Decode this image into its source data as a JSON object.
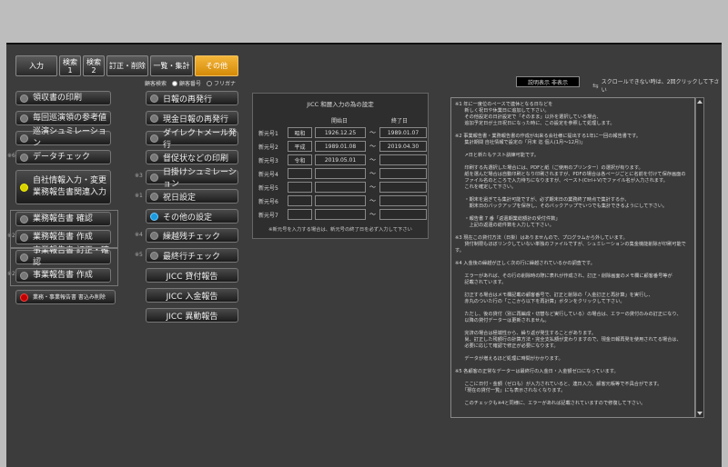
{
  "tabs": [
    {
      "label": "入力",
      "active": false
    },
    {
      "label": "検索\n1",
      "active": false
    },
    {
      "label": "検索\n2",
      "active": false
    },
    {
      "label": "訂正・削除",
      "active": false
    },
    {
      "label": "一覧・集計",
      "active": false
    },
    {
      "label": "その他",
      "active": true
    }
  ],
  "search_mode": {
    "label": "顧客検索",
    "opt1": "顧客番号",
    "opt2": "フリガナ",
    "selected": "顧客番号"
  },
  "left_buttons": [
    {
      "label": "領収書の印刷",
      "dot": "gray"
    },
    {
      "label": "毎回巡演領の参考値",
      "dot": "gray"
    },
    {
      "label": "巡演シュミレーション",
      "dot": "gray"
    },
    {
      "label": "データチェック",
      "dot": "gray"
    },
    {
      "label": "自社情報入力・変更\n業務報告書関連入力",
      "dot": "yellow"
    },
    {
      "label": "業務報告書 確認",
      "dot": "gray"
    },
    {
      "label": "業務報告書 作成",
      "dot": "gray"
    },
    {
      "label": "事業報告書 訂正・確認",
      "dot": "gray"
    },
    {
      "label": "事業報告書 作成",
      "dot": "gray"
    },
    {
      "label": "業務・事業報告書 書込み削除",
      "dot": "red"
    }
  ],
  "left_notes": [
    "※6",
    "※2",
    "※2"
  ],
  "mid_buttons": [
    {
      "label": "日報の再発行",
      "dot": "gray"
    },
    {
      "label": "現金日報の再発行",
      "dot": "gray"
    },
    {
      "label": "ダイレクトメール発行",
      "dot": "gray"
    },
    {
      "label": "督促状などの印刷",
      "dot": "gray"
    },
    {
      "label": "日掛けシュミレーション",
      "dot": "gray"
    },
    {
      "label": "祝日設定",
      "dot": "gray"
    },
    {
      "label": "その他の設定",
      "dot": "blue"
    },
    {
      "label": "繰越残チェック",
      "dot": "gray"
    },
    {
      "label": "最終行チェック",
      "dot": "gray"
    },
    {
      "label": "JICC 貸付報告",
      "dot": "none"
    },
    {
      "label": "JICC 入金報告",
      "dot": "none"
    },
    {
      "label": "JICC 異動報告",
      "dot": "none"
    }
  ],
  "mid_notes": [
    "※3",
    "※1",
    "※4",
    "※5"
  ],
  "era_panel": {
    "title": "JICC 和暦入力の為の設定",
    "col_start": "開始日",
    "col_end": "終了日",
    "rows": [
      {
        "label": "新元号1",
        "name": "昭和",
        "start": "1926.12.25",
        "end": "1989.01.07"
      },
      {
        "label": "新元号2",
        "name": "平成",
        "start": "1989.01.08",
        "end": "2019.04.30"
      },
      {
        "label": "新元号3",
        "name": "令和",
        "start": "2019.05.01",
        "end": ""
      },
      {
        "label": "新元号4",
        "name": "",
        "start": "",
        "end": ""
      },
      {
        "label": "新元号5",
        "name": "",
        "start": "",
        "end": ""
      },
      {
        "label": "新元号6",
        "name": "",
        "start": "",
        "end": ""
      },
      {
        "label": "新元号7",
        "name": "",
        "start": "",
        "end": ""
      }
    ],
    "tilde": "〜",
    "footer": "※新元号を入力する場合は、新元号の終了日を必ず入力して下さい"
  },
  "desc_label": "説明表示 非表示",
  "scroll_hint": "スクロールできない時は、2回クリックして下さい",
  "notes_text": "※1 年に一度位のペースで連休となる日などを\n　　新しく祝日や休業日に追加して下さい。\n　　その他設定の日計設定で「そのまま」以外を選択している場合、\n　　追加予定日が土日祝日になった時に、この設定を参照して処理します。\n\n※2 事業報告書・業務報告書の作成が出来る会社様に提出する1年に一回の報告書です。\n　　集計期間 自社情報で設定の「月末 迄 個人(1月〜12月)」\n\n　　↗日と新たもテスト訓練可能です。\n\n　　印刷する先選択した場合には、PDFと紙（ご使用のプリンター）の選択が有ります。\n　　紙を選んだ場合は自動印刷となり印刷されますが、PDFの場合は各ページごとに名前を付けて保存画面の\n　　ファイル名のところで入力待ちになりますが、ペースト(Ctrl＋V)でファイル名が入力されます。\n　　これを確定して下さい。\n\n　　・期末を過ぎても集計可能ですが、必ず期末日の業務終了時点で集計するか、\n　　　期末日のバックアップを保存し、そのバックアップでいつでも集計できるようにして下さい。\n\n　　・報告書 7 番「返還期業総額計の受付件数」\n　　　上記の返還の総件数を入力して下さい。\n\n※3 現在この貸付方法（日掛）はありませんので、プログラムから外しています。\n　　貸付制限もほぼリンクしていない単独のファイルですが、シュミレーションの集金機能削除が印刷可能です。\n\n※4 入金後の繰越が正しく次の行に繰越されているかの調査です。\n\n　　エラーがあれば、その行の削除時の際に表れが作成され、訂正・削除画面のメモ欄に顧客番号等が\n　　記載されています。\n\n　　訂正する場合はメモ欄記載の顧客番号で、訂正と削除の「入金訂正と再計算」を実行し、\n　　赤丸のついた行の「ここから以下を再計算」ボタンをクリックして下さい。\n\n　　ただし、後の貸付（別に再編成・切替など実行している）の場合は、エラーの貸付のみの訂正になり、\n　　以降の貸付データーは更新されません。\n\n　　完済の場合は極端性から、繰り返が発生することがあります。\n　　尚、訂正した残額行の計算方法・完全支払額が変わりますので、現金日報再発を使用されてる場合は、\n　　必要に応じて確認で修正が必要になります。\n\n　　データが増えるほど処理に時間がかかります。\n\n※5 各顧客の正常なデーターは最終行の入金日・入金額ゼロになっています。\n\n　　ここに日付・金額（ゼロも）が入力されていると、連日入力、顧客元帳等で不具合がでます。\n　　「現在の貸付一覧」にも表示されなくなります。\n\n　　このチェックも※4と同様に、エラーがあれば記載されていますので修復して下さい。"
}
